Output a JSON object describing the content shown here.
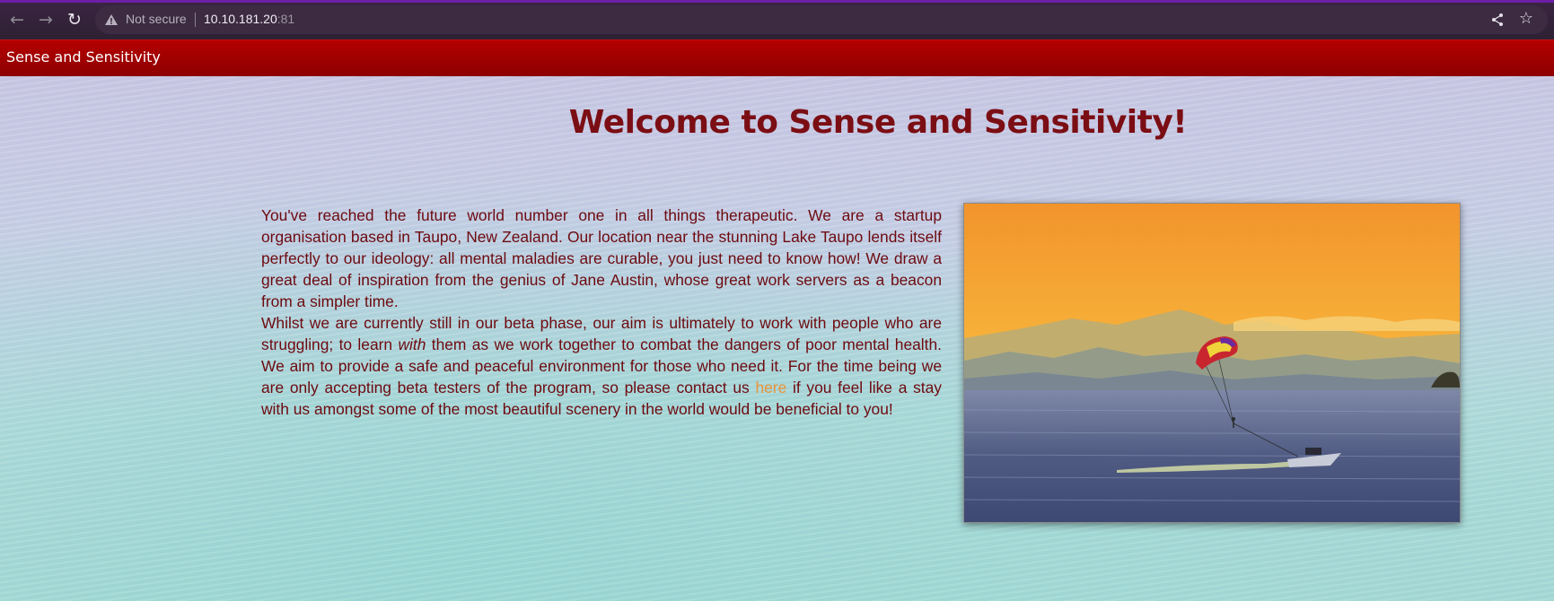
{
  "browser": {
    "security_label": "Not secure",
    "url_host": "10.10.181.20",
    "url_port": ":81",
    "icons": [
      "back-arrow-icon",
      "forward-arrow-icon",
      "reload-icon",
      "warning-icon",
      "share-icon",
      "star-icon"
    ]
  },
  "site": {
    "brand": "Sense and Sensitivity",
    "heading": "Welcome to Sense and Sensitivity!",
    "paragraph1": "You've reached the future world number one in all things therapeutic. We are a startup organisation based in Taupo, New Zealand. Our location near the stunning Lake Taupo lends itself perfectly to our ideology: all mental maladies are curable, you just need to know how! We draw a great deal of inspiration from the genius of Jane Austin, whose great work servers as a beacon from a simpler time.",
    "paragraph2": {
      "part1": "Whilst we are currently still in our beta phase, our aim is ultimately to work with people who are struggling; to learn ",
      "emphasis": "with",
      "part2": " them as we work together to combat the dangers of poor mental health. We aim to provide a safe and peaceful environment for those who need it. For the time being we are only accepting beta testers of the program, so please contact us ",
      "link_text": "here",
      "part3": " if you feel like a stay with us amongst some of the most beautiful scenery in the world would be beneficial to you!"
    }
  },
  "colors": {
    "header_red": "#a00000",
    "heading_text": "#7b0e14",
    "body_text": "#6d0a10",
    "link": "#e8933a"
  }
}
